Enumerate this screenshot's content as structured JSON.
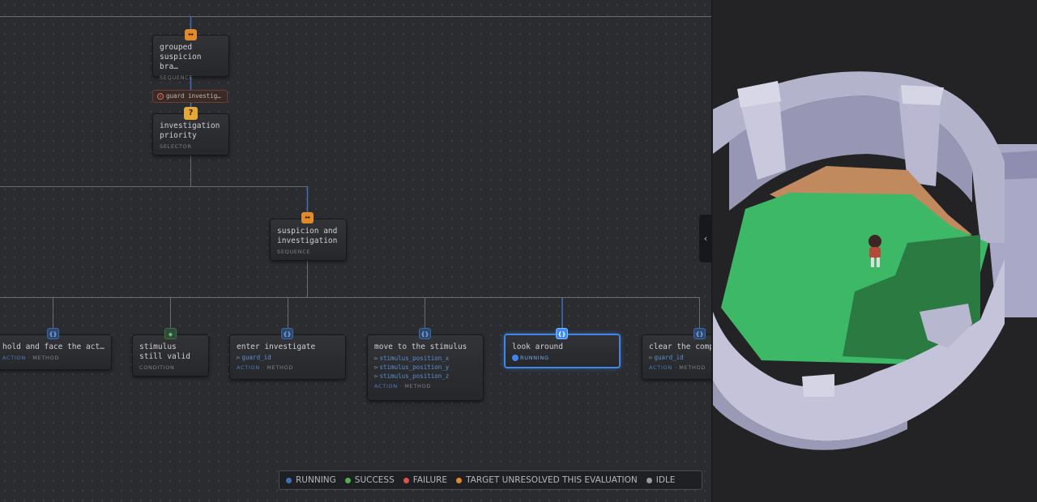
{
  "graph": {
    "nodes": {
      "grouped": {
        "title": "grouped\nsuspicion bra…",
        "kind": "SEQUENCE",
        "icon": "sequence-arrows"
      },
      "decorator": {
        "label": "guard investig…",
        "icon": "decorator-x"
      },
      "priority": {
        "title": "investigation\npriority",
        "kind": "SELECTOR",
        "icon": "question-mark"
      },
      "suspicion": {
        "title": "suspicion and\ninvestigation",
        "kind": "SEQUENCE",
        "icon": "sequence-arrows"
      },
      "hold": {
        "title": "hold and face the act…",
        "kind_action": "ACTION",
        "kind_rest": " · METHOD",
        "icon": "braces"
      },
      "stimulus": {
        "title": "stimulus\nstill valid",
        "kind": "CONDITION",
        "icon": "diamond"
      },
      "enter": {
        "title": "enter investigate",
        "params": [
          "guard_id"
        ],
        "kind_action": "ACTION",
        "kind_rest": " · METHOD",
        "icon": "braces"
      },
      "move": {
        "title": "move to the stimulus",
        "params": [
          "stimulus_position_x",
          "stimulus_position_y",
          "stimulus_position_z"
        ],
        "kind_action": "ACTION",
        "kind_rest": " · METHOD",
        "icon": "braces"
      },
      "look": {
        "title": "look around",
        "status": "RUNNING",
        "icon": "braces"
      },
      "clear": {
        "title": "clear the comp",
        "params": [
          "guard_id"
        ],
        "kind_action": "ACTION",
        "kind_rest": " · METHOD",
        "icon": "braces"
      }
    }
  },
  "legend": [
    {
      "label": "RUNNING",
      "color": "#3f6fb8"
    },
    {
      "label": "SUCCESS",
      "color": "#4fb04f"
    },
    {
      "label": "FAILURE",
      "color": "#d9534f"
    },
    {
      "label": "TARGET UNRESOLVED THIS EVALUATION",
      "color": "#e08a2a"
    },
    {
      "label": "IDLE",
      "color": "#9a9a9a"
    }
  ],
  "panel": {
    "collapse_icon": "chevron-left-icon",
    "collapse_glyph": "‹"
  },
  "colors": {
    "running": "#3f86e8",
    "wire": "#6a6b70",
    "active_wire": "#3f6fb8"
  }
}
